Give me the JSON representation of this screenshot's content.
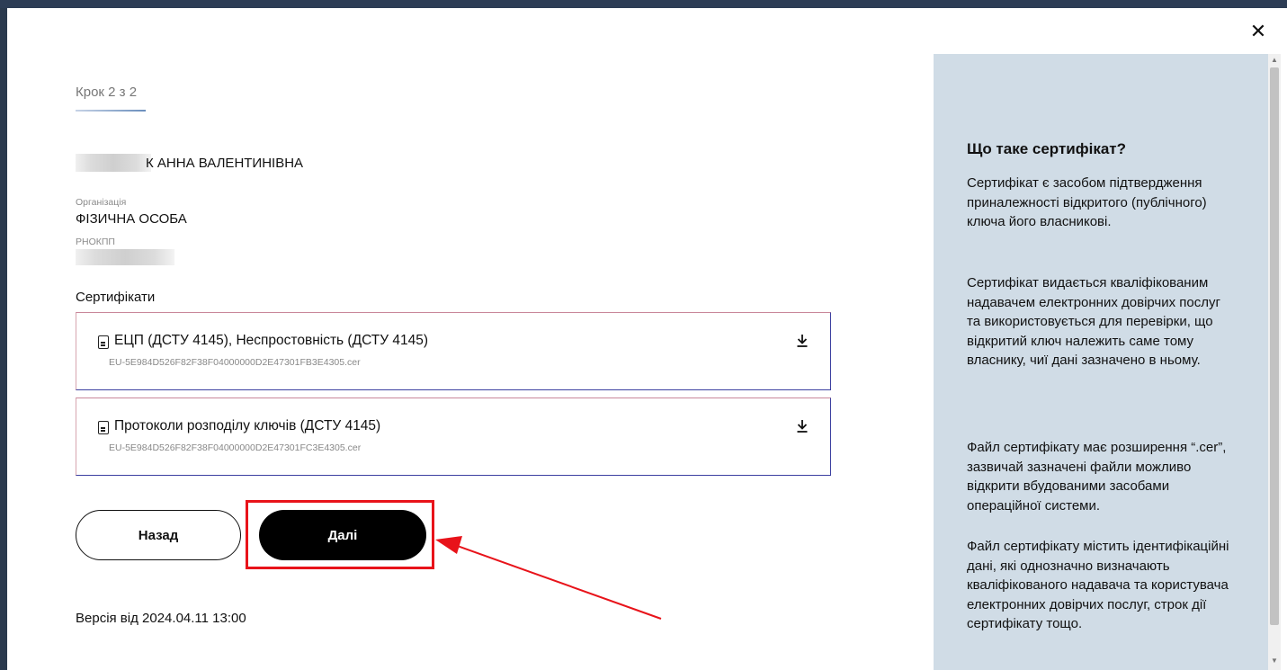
{
  "dialog": {
    "close_label": "✕"
  },
  "wizard": {
    "step_label": "Крок 2 з 2"
  },
  "profile": {
    "name": "К АННА ВАЛЕНТИНІВНА",
    "organization_label": "Організація",
    "organization_value": "ФІЗИЧНА ОСОБА",
    "rnokpp_label": "РНОКПП"
  },
  "certificates": {
    "title": "Сертифікати",
    "items": [
      {
        "title": "ЕЦП (ДСТУ 4145), Неспростовність (ДСТУ 4145)",
        "file": "EU-5E984D526F82F38F04000000D2E47301FB3E4305.cer"
      },
      {
        "title": "Протоколи розподілу ключів (ДСТУ 4145)",
        "file": "EU-5E984D526F82F38F04000000D2E47301FC3E4305.cer"
      }
    ]
  },
  "actions": {
    "back_label": "Назад",
    "next_label": "Далі"
  },
  "footer": {
    "version": "Версія від 2024.04.11 13:00"
  },
  "help": {
    "title": "Що таке сертифікат?",
    "paragraphs": [
      "Сертифікат є засобом підтвердження приналежності відкритого (публічного) ключа його власникові.",
      "Сертифікат видається кваліфікованим надавачем електронних довірчих послуг та використовується для перевірки, що відкритий ключ належить саме тому власнику, чиї дані зазначено в ньому.",
      "Файл сертифікату має розширення “.cer”, зазвичай зазначені файли можливо відкрити вбудованими засобами операційної системи.",
      "Файл сертифікату містить ідентифікаційні дані, які однозначно визначають кваліфікованого надавача та користувача електронних довірчих послуг, строк дії сертифікату тощо."
    ]
  },
  "colors": {
    "highlight": "#e8131a",
    "side_panel": "#d0dce6",
    "primary_button": "#000000"
  }
}
